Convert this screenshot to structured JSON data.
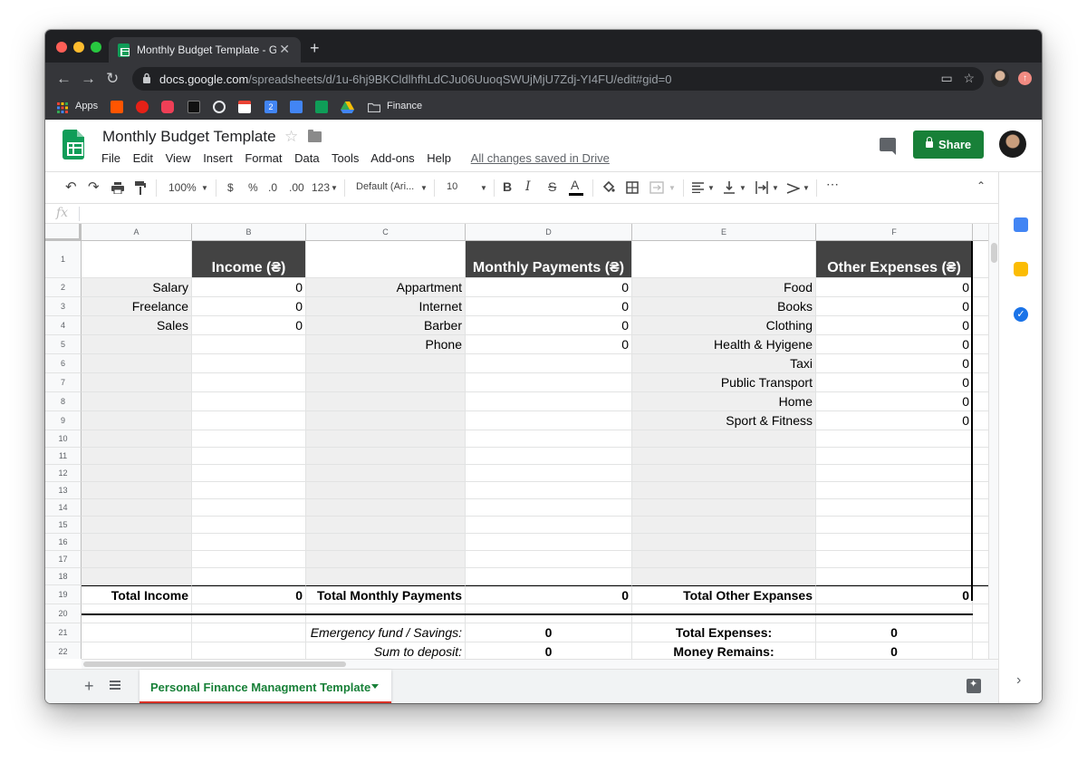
{
  "browser": {
    "tab_title": "Monthly Budget Template - Google Sheets",
    "url_host": "docs.google.com",
    "url_path": "/spreadsheets/d/1u-6hj9BKCldlhfhLdCJu06UuoqSWUjMjU7Zdj-YI4FU/edit#gid=0",
    "bookmarks": {
      "apps_label": "Apps",
      "folder_label": "Finance",
      "calendar_day": "2"
    }
  },
  "doc": {
    "title": "Monthly Budget Template",
    "menus": [
      "File",
      "Edit",
      "View",
      "Insert",
      "Format",
      "Data",
      "Tools",
      "Add-ons",
      "Help"
    ],
    "saved_status": "All changes saved in Drive",
    "share_label": "Share"
  },
  "toolbar": {
    "zoom": "100%",
    "currency": "$",
    "percent": "%",
    "dec_less": ".0",
    "dec_more": ".00",
    "more_formats": "123",
    "font": "Default (Ari...",
    "font_size": "10",
    "bold": "B",
    "italic": "I",
    "strike": "S",
    "text_color": "A"
  },
  "formula_bar": {
    "fx_label": "fx"
  },
  "grid": {
    "columns": [
      "A",
      "B",
      "C",
      "D",
      "E",
      "F"
    ],
    "rows": [
      "1",
      "2",
      "3",
      "4",
      "5",
      "6",
      "7",
      "8",
      "9",
      "10",
      "11",
      "12",
      "13",
      "14",
      "15",
      "16",
      "17",
      "18",
      "19",
      "20",
      "21",
      "22"
    ],
    "headers": {
      "income": "Income (₴)",
      "monthly": "Monthly Payments (₴)",
      "other": "Other Expenses (₴)"
    },
    "income_items": [
      {
        "label": "Salary",
        "value": "0"
      },
      {
        "label": "Freelance",
        "value": "0"
      },
      {
        "label": "Sales",
        "value": "0"
      }
    ],
    "monthly_items": [
      {
        "label": "Appartment",
        "value": "0"
      },
      {
        "label": "Internet",
        "value": "0"
      },
      {
        "label": "Barber",
        "value": "0"
      },
      {
        "label": "Phone",
        "value": "0"
      }
    ],
    "other_items": [
      {
        "label": "Food",
        "value": "0"
      },
      {
        "label": "Books",
        "value": "0"
      },
      {
        "label": "Clothing",
        "value": "0"
      },
      {
        "label": "Health & Hyigene",
        "value": "0"
      },
      {
        "label": "Taxi",
        "value": "0"
      },
      {
        "label": "Public Transport",
        "value": "0"
      },
      {
        "label": "Home",
        "value": "0"
      },
      {
        "label": "Sport & Fitness",
        "value": "0"
      }
    ],
    "totals": {
      "income_label": "Total Income",
      "income_value": "0",
      "monthly_label": "Total Monthly Payments",
      "monthly_value": "0",
      "other_label": "Total Other Expanses",
      "other_value": "0"
    },
    "summary": {
      "emergency_label": "Emergency fund / Savings:",
      "emergency_value": "0",
      "deposit_label": "Sum to deposit:",
      "deposit_value": "0",
      "expenses_label": "Total Expenses:",
      "expenses_value": "0",
      "remains_label": "Money Remains:",
      "remains_value": "0"
    }
  },
  "sheet_tab": {
    "name": "Personal Finance Managment Template"
  },
  "colors": {
    "header_fill": "#434343",
    "label_fill": "#efefef",
    "brand_green": "#188038",
    "active_tab_underline": "#d93025"
  }
}
